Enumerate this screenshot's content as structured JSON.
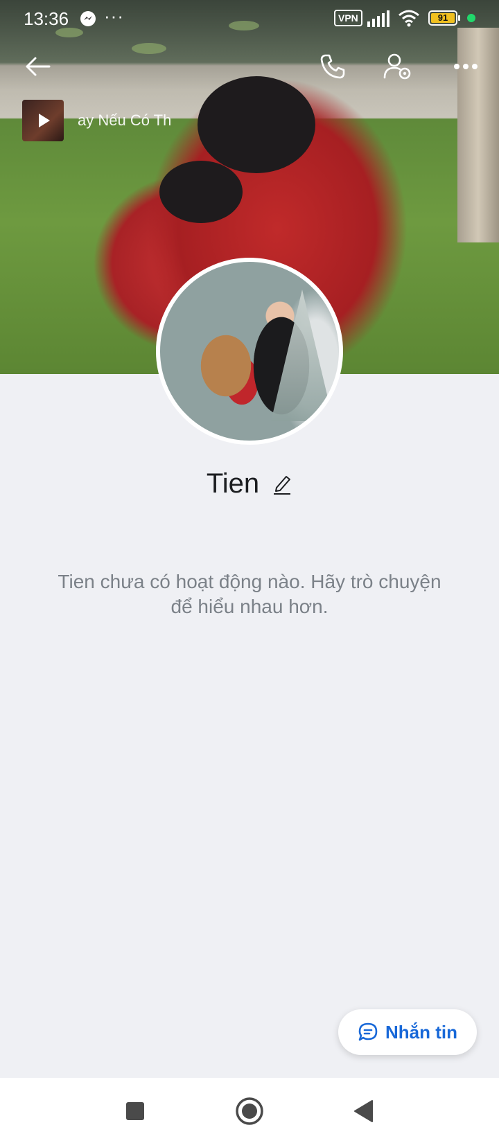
{
  "status_bar": {
    "time": "13:36",
    "messenger_icon": "messenger-icon",
    "more_notifications": "···",
    "vpn_label": "VPN",
    "battery_level": "91",
    "colors": {
      "battery": "#f0c020",
      "dot": "#21d86b"
    }
  },
  "header": {
    "back_icon": "arrow-left-icon",
    "call_icon": "phone-icon",
    "settings_icon": "user-settings-icon",
    "more_icon": "more-dots-icon"
  },
  "music": {
    "title": "ay Nếu Có Th",
    "play_icon": "play-icon"
  },
  "profile": {
    "name": "Tien",
    "edit_icon": "pencil-icon",
    "empty_message": "Tien chưa có hoạt động nào. Hãy trò chuyện để hiểu nhau hơn."
  },
  "actions": {
    "message_label": "Nhắn tin",
    "message_icon": "chat-bubble-icon",
    "accent": "#1868d8"
  },
  "system_nav": {
    "recent_icon": "recent-apps-icon",
    "home_icon": "home-icon",
    "back_icon": "back-triangle-icon"
  }
}
